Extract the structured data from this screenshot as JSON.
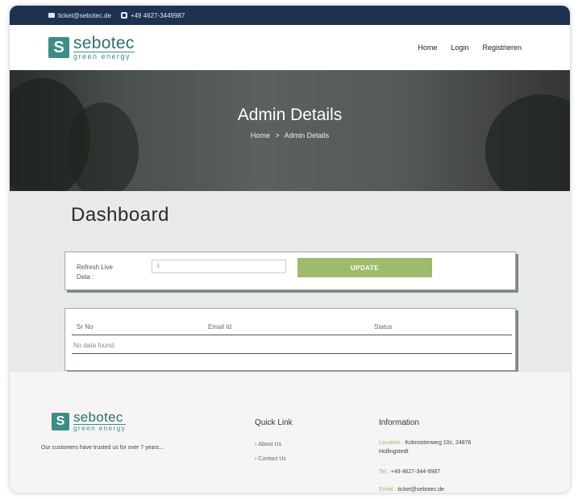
{
  "topbar": {
    "email": "ticket@sebotec.de",
    "phone": "+49 4627-3449987"
  },
  "brand": {
    "mark": "S",
    "name": "sebotec",
    "tagline": "green energy"
  },
  "nav": {
    "home": "Home",
    "login": "Login",
    "register": "Registrieren"
  },
  "hero": {
    "title": "Admin Details",
    "crumb_home": "Home",
    "crumb_sep": ">",
    "crumb_current": "Admin Details"
  },
  "dashboard": {
    "title": "Dashboard"
  },
  "refresh": {
    "label_line1": "Refresh Live",
    "label_line2": "Data :",
    "value": "3",
    "button": "UPDATE"
  },
  "table": {
    "headers": [
      "Sr No",
      "Email Id",
      "Status"
    ],
    "empty_text": "No data found."
  },
  "footer": {
    "tagline": "Our customers have trusted us for over 7 years...",
    "quick_link_title": "Quick Link",
    "links": [
      "About Us",
      "Contact Us"
    ],
    "info_title": "Information",
    "location_label": "Location :",
    "location_value": "Kolonistenweg 10c, 24876",
    "location_value2": "Hollingstedt",
    "tel_label": "Tel :",
    "tel_value": "+49 4627-344-9987",
    "email_label": "Email :",
    "email_value": "ticket@sebotec.de"
  },
  "colors": {
    "accent": "#9dbb6b",
    "brand": "#3c8d86",
    "topbar": "#1f3150"
  }
}
